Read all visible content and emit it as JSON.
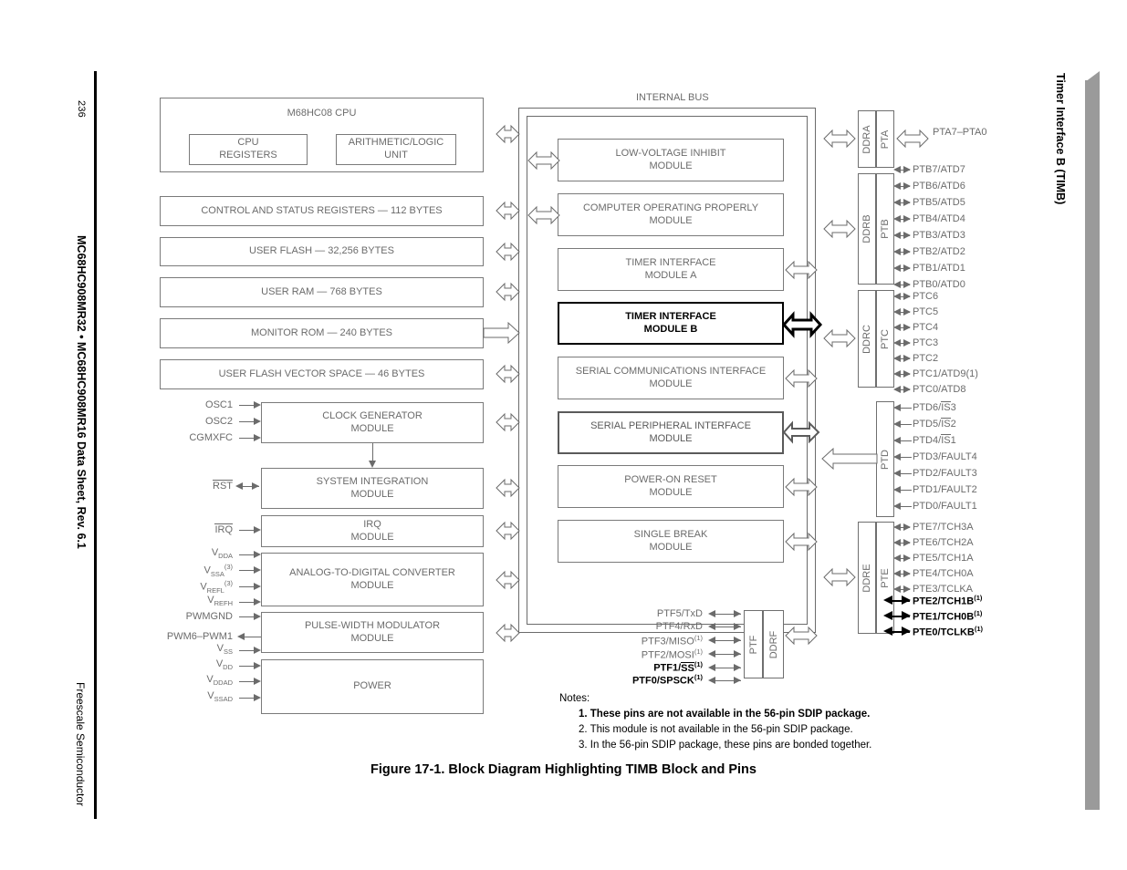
{
  "page": {
    "number": "236",
    "spine_title": "MC68HC908MR32 • MC68HC908MR16 Data Sheet, Rev. 6.1",
    "spine_footer": "Freescale Semiconductor",
    "tab_title": "Timer Interface B (TIMB)",
    "figure_caption": "Figure 17-1. Block Diagram Highlighting TIMB Block and Pins"
  },
  "bus": {
    "label": "INTERNAL BUS"
  },
  "cpu": {
    "title": "M68HC08 CPU",
    "registers": "CPU\nREGISTERS",
    "alu": "ARITHMETIC/LOGIC\nUNIT"
  },
  "memory_blocks": [
    {
      "label": "CONTROL AND STATUS REGISTERS — 112 BYTES",
      "arrow": "bidir"
    },
    {
      "label": "USER FLASH — 32,256 BYTES",
      "arrow": "bidir"
    },
    {
      "label": "USER RAM — 768 BYTES",
      "arrow": "bidir"
    },
    {
      "label": "MONITOR ROM — 240 BYTES",
      "arrow": "right"
    },
    {
      "label": "USER FLASH VECTOR SPACE — 46 BYTES",
      "arrow": "bidir"
    }
  ],
  "left_modules": [
    {
      "label": "CLOCK GENERATOR\nMODULE",
      "pins": [
        "OSC1",
        "OSC2",
        "CGMXFC"
      ]
    },
    {
      "label": "SYSTEM INTEGRATION\nMODULE",
      "pins": [
        "RST"
      ]
    },
    {
      "label": "IRQ\nMODULE",
      "pins": [
        "IRQ"
      ]
    },
    {
      "label": "ANALOG-TO-DIGITAL CONVERTER\nMODULE",
      "pins": [
        "VDDA",
        "VSSA(3)",
        "VREFL(3)",
        "VREFH"
      ]
    },
    {
      "label": "PULSE-WIDTH MODULATOR\nMODULE",
      "pins": [
        "PWMGND",
        "PWM6–PWM1"
      ]
    },
    {
      "label": "POWER",
      "pins": [
        "VSS",
        "VDD",
        "VDDAD",
        "VSSAD"
      ]
    }
  ],
  "center_modules": [
    {
      "label": "LOW-VOLTAGE INHIBIT\nMODULE",
      "style": "plain",
      "right_arrow": false
    },
    {
      "label": "COMPUTER OPERATING PROPERLY\nMODULE",
      "style": "plain",
      "right_arrow": false
    },
    {
      "label": "TIMER INTERFACE\nMODULE A",
      "style": "plain",
      "right_arrow": true
    },
    {
      "label": "TIMER INTERFACE\nMODULE B",
      "style": "highlight",
      "right_arrow": true
    },
    {
      "label": "SERIAL COMMUNICATIONS INTERFACE\nMODULE",
      "style": "plain",
      "right_arrow": true
    },
    {
      "label": "SERIAL PERIPHERAL INTERFACE\nMODULE",
      "style": "medium",
      "right_arrow": true
    },
    {
      "label": "POWER-ON RESET\nMODULE",
      "style": "plain",
      "right_arrow": true
    },
    {
      "label": "SINGLE BREAK\nMODULE",
      "style": "plain",
      "right_arrow": true
    }
  ],
  "ports": [
    {
      "ddr": "DDRA",
      "port": "PTA",
      "bus_label": "PTA7–PTA0",
      "pins": []
    },
    {
      "ddr": "DDRB",
      "port": "PTB",
      "bus_label": "",
      "pins": [
        "PTB7/ATD7",
        "PTB6/ATD6",
        "PTB5/ATD5",
        "PTB4/ATD4",
        "PTB3/ATD3",
        "PTB2/ATD2",
        "PTB1/ATD1",
        "PTB0/ATD0"
      ]
    },
    {
      "ddr": "DDRC",
      "port": "PTC",
      "bus_label": "",
      "pins": [
        "PTC6",
        "PTC5",
        "PTC4",
        "PTC3",
        "PTC2",
        "PTC1/ATD9(1)",
        "PTC0/ATD8"
      ]
    },
    {
      "ddr": "",
      "port": "PTD",
      "bus_label": "",
      "pins": [
        "PTD6/IS3",
        "PTD5/IS2",
        "PTD4/IS1",
        "PTD3/FAULT4",
        "PTD2/FAULT3",
        "PTD1/FAULT2",
        "PTD0/FAULT1"
      ]
    },
    {
      "ddr": "DDRE",
      "port": "PTE",
      "bus_label": "",
      "pins": [
        "PTE7/TCH3A",
        "PTE6/TCH2A",
        "PTE5/TCH1A",
        "PTE4/TCH0A",
        "PTE3/TCLKA",
        "PTE2/TCH1B(1)",
        "PTE1/TCH0B(1)",
        "PTE0/TCLKB(1)"
      ]
    }
  ],
  "portf": {
    "port": "PTF",
    "ddr": "DDRF",
    "pins": [
      "PTF5/TxD",
      "PTF4/RxD",
      "PTF3/MISO(1)",
      "PTF2/MOSI(1)",
      "PTF1/SS(1)",
      "PTF0/SPSCK(1)"
    ]
  },
  "notes": {
    "heading": "Notes:",
    "items": [
      "1. These pins are not available in the 56-pin SDIP package.",
      "2. This module is not available in the 56-pin SDIP package.",
      "3. In the 56-pin SDIP package, these pins are bonded together."
    ]
  },
  "colors": {
    "line": "#6b6b6b",
    "highlight": "#000000",
    "tab": "#9a9a9a"
  }
}
